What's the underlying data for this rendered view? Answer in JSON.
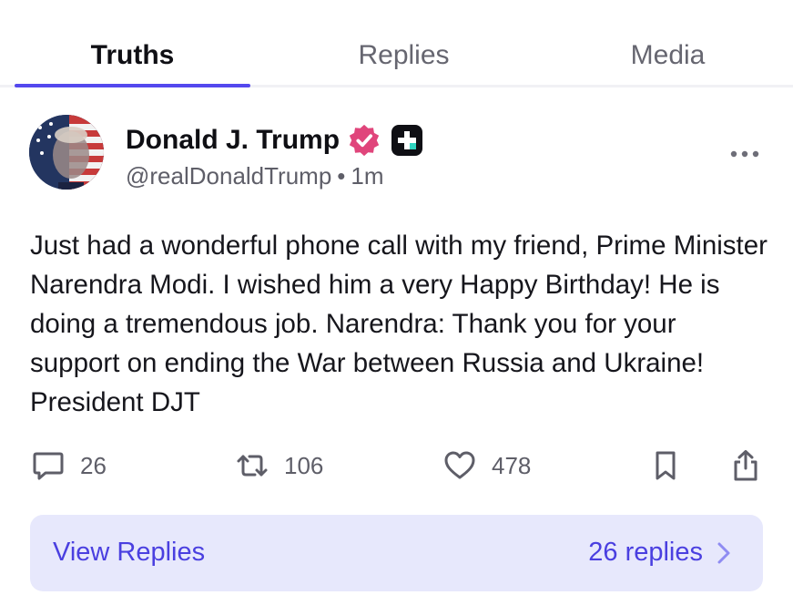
{
  "tabs": [
    {
      "label": "Truths",
      "active": true
    },
    {
      "label": "Replies",
      "active": false
    },
    {
      "label": "Media",
      "active": false
    }
  ],
  "post": {
    "author": {
      "display_name": "Donald J. Trump",
      "handle": "@realDonaldTrump",
      "verified_icon": "verified-badge-icon",
      "plus_icon": "plus-badge-icon"
    },
    "separator": "•",
    "timestamp": "1m",
    "text": "Just had a wonderful phone call with my friend, Prime Minister Narendra Modi. I wished him a very Happy Birthday! He is doing a tremendous job. Narendra: Thank you for your support on ending the War between Russia and Ukraine! President DJT",
    "actions": {
      "replies": "26",
      "retruths": "106",
      "likes": "478"
    }
  },
  "view_replies": {
    "label": "View Replies",
    "count_label": "26 replies"
  },
  "colors": {
    "accent": "#5448ee",
    "verified": "#e0457b",
    "view_replies_bg": "#e7e8fc",
    "view_replies_text": "#4a3fe0"
  }
}
